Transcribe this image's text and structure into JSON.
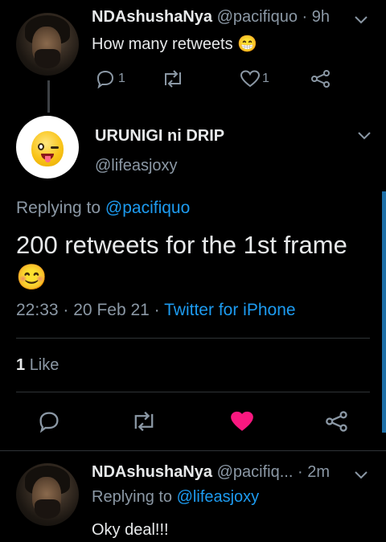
{
  "tweet1": {
    "display_name": "NDAshushaNya",
    "handle": "@pacifiquo",
    "separator": "·",
    "time": "9h",
    "text": "How many retweets",
    "emoji": "😁",
    "reply_count": "1",
    "like_count": "1"
  },
  "main_tweet": {
    "display_name": "URUNIGI ni DRIP",
    "handle": "@lifeasjoxy",
    "replying_prefix": "Replying to",
    "replying_to": "@pacifiquo",
    "text": "200 retweets for the 1st frame",
    "emoji": "😊",
    "time": "22:33",
    "dot1": "·",
    "date": "20 Feb 21",
    "dot2": "·",
    "source": "Twitter for iPhone",
    "like_number": "1",
    "like_word": "Like"
  },
  "tweet3": {
    "display_name": "NDAshushaNya",
    "handle": "@pacifiq...",
    "separator": "·",
    "time": "2m",
    "replying_prefix": "Replying to",
    "replying_to": "@lifeasjoxy",
    "text": "Oky deal!!!"
  },
  "colors": {
    "background": "#000000",
    "link": "#1d9bf0",
    "muted": "#8b98a5",
    "like_active": "#f91880"
  }
}
